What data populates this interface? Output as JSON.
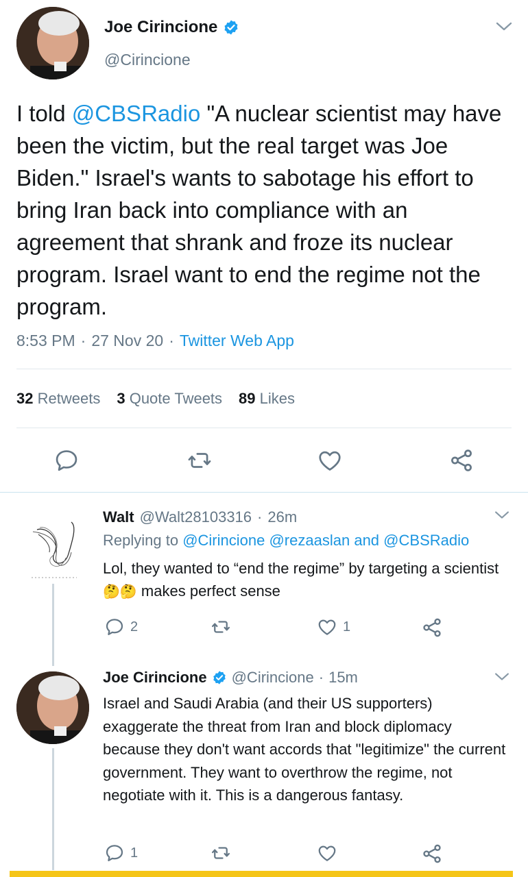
{
  "main_tweet": {
    "author_name": "Joe Cirincione",
    "handle": "@Cirincione",
    "text_parts": {
      "p1": "I told ",
      "mention": "@CBSRadio",
      "p2": " \"A nuclear scientist may have been the victim, but the real target was Joe Biden.\" Israel's wants to sabotage his effort to bring Iran back into compliance with an agreement that shrank and froze its nuclear program. Israel want to end the regime not the program."
    },
    "time": "8:53 PM",
    "date": "27 Nov 20",
    "source": "Twitter Web App",
    "retweets_count": "32",
    "retweets_label": "Retweets",
    "quotes_count": "3",
    "quotes_label": "Quote Tweets",
    "likes_count": "89",
    "likes_label": "Likes",
    "sep": "·"
  },
  "reply1": {
    "author_name": "Walt",
    "handle": "@Walt28103316",
    "time": "26m",
    "replying_prefix": "Replying to",
    "reply_mentions": "@Cirincione @rezaaslan",
    "reply_and": "and",
    "reply_last": "@CBSRadio",
    "text_a": "Lol, they wanted to “end the regime” by targeting a scientist",
    "emoji": "🤔🤔",
    "text_b": " makes perfect sense",
    "reply_count": "2",
    "retweet_count": "",
    "like_count": "1"
  },
  "reply2": {
    "author_name": "Joe Cirincione",
    "handle": "@Cirincione",
    "time": "15m",
    "text": "Israel and Saudi Arabia (and their US supporters) exaggerate the threat from Iran and block diplomacy because they don't want accords that \"legitimize\" the current government. They want to overthrow the regime, not negotiate with it. This is a dangerous fantasy.",
    "reply_count": "1",
    "like_count": ""
  },
  "colors": {
    "link": "#1b95e0",
    "muted": "#657786",
    "divider": "#e1e8ed",
    "bottom_bar": "#f5c518"
  },
  "icons": {
    "verified": "verified-badge-icon",
    "chevron": "chevron-down-icon",
    "reply": "reply-icon",
    "retweet": "retweet-icon",
    "like": "heart-icon",
    "share": "share-icon"
  }
}
